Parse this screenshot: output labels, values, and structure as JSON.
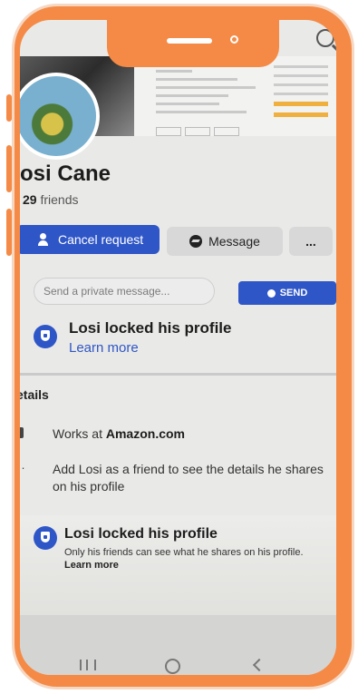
{
  "profile": {
    "name": "osi Cane",
    "friends_count": "29",
    "friends_label": "friends"
  },
  "actions": {
    "cancel_request": "Cancel request",
    "message": "Message",
    "more": "..."
  },
  "message_box": {
    "placeholder": "Send a private message...",
    "send": "SEND"
  },
  "locked_notice": {
    "title": "Losi locked his profile",
    "link": "Learn more"
  },
  "details": {
    "heading": "etails",
    "works_prefix": "Works at",
    "works_company": "Amazon.com",
    "add_friend_text": "Add Losi as a friend to see the details he shares on his profile"
  },
  "locked_card": {
    "title": "Losi locked his profile",
    "description": "Only his friends can see what he shares on his profile.",
    "more": "Learn more"
  },
  "colors": {
    "phone_frame": "#f48a45",
    "primary": "#2f56c7",
    "background": "#e9e9e7"
  }
}
